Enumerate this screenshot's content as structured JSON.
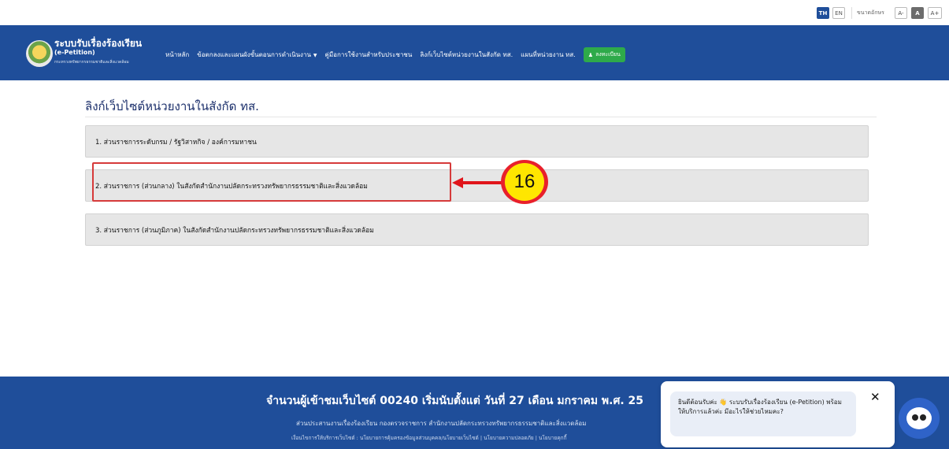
{
  "topbar": {
    "lang_th": "TH",
    "lang_en": "EN",
    "font_size_label": "ขนาดอักษร",
    "font_small": "A-",
    "font_normal": "A",
    "font_large": "A+"
  },
  "header": {
    "brand_title": "ระบบรับเรื่องร้องเรียน",
    "brand_subtitle": "(e-Petition)",
    "brand_org": "กระทรวงทรัพยากรธรรมชาติและสิ่งแวดล้อม",
    "nav": [
      {
        "label": "หน้าหลัก"
      },
      {
        "label": "ข้อตกลงและแผนผังขั้นตอนการดำเนินงาน"
      },
      {
        "label": "คู่มือการใช้งานสำหรับประชาชน"
      },
      {
        "label": "ลิงก์เว็บไซต์หน่วยงานในสังกัด ทส."
      },
      {
        "label": "แผนที่หน่วยงาน ทส."
      }
    ],
    "register_label": "ลงทะเบียน"
  },
  "main": {
    "title": "ลิงก์เว็บไซต์หน่วยงานในสังกัด ทส.",
    "sections": [
      {
        "label": "1. ส่วนราชการระดับกรม / รัฐวิสาหกิจ / องค์การมหาชน"
      },
      {
        "label": "2. ส่วนราชการ (ส่วนกลาง) ในสังกัดสำนักงานปลัดกระทรวงทรัพยากรธรรมชาติและสิ่งแวดล้อม"
      },
      {
        "label": "3. ส่วนราชการ (ส่วนภูมิภาค) ในสังกัดสำนักงานปลัดกระทรวงทรัพยากรธรรมชาติและสิ่งแวดล้อม"
      }
    ]
  },
  "annotation": {
    "step_number": "16",
    "color": "#e0151b",
    "badge_color": "#ffe600"
  },
  "footer": {
    "visit_count": "จำนวนผู้เข้าชมเว็บไซต์ 00240 เริ่มนับตั้งแต่ วันที่ 27 เดือน มกราคม พ.ศ. 25",
    "org_line": "ส่วนประสานงานเรื่องร้องเรียน กองตรวจราชการ สำนักงานปลัดกระทรวงทรัพยากรธรรมชาติและสิ่งแวดล้อม",
    "links_line": "เงื่อนไขการให้บริการเว็บไซต์ : นโยบายการคุ้มครองข้อมูลส่วนบุคคล/นโยบายเว็บไซต์ | นโยบายความปลอดภัย | นโยบายคุกกี้"
  },
  "chat": {
    "message": "ยินดีต้อนรับค่ะ 👋 ระบบรับเรื่องร้องเรียน (e-Petition) พร้อมให้บริการแล้วค่ะ มีอะไรให้ช่วยไหมคะ?",
    "close_icon": "close-icon"
  },
  "colors": {
    "primary": "#1f4e9a",
    "register_green": "#2eaa4a",
    "title_navy": "#1b2f6b"
  }
}
